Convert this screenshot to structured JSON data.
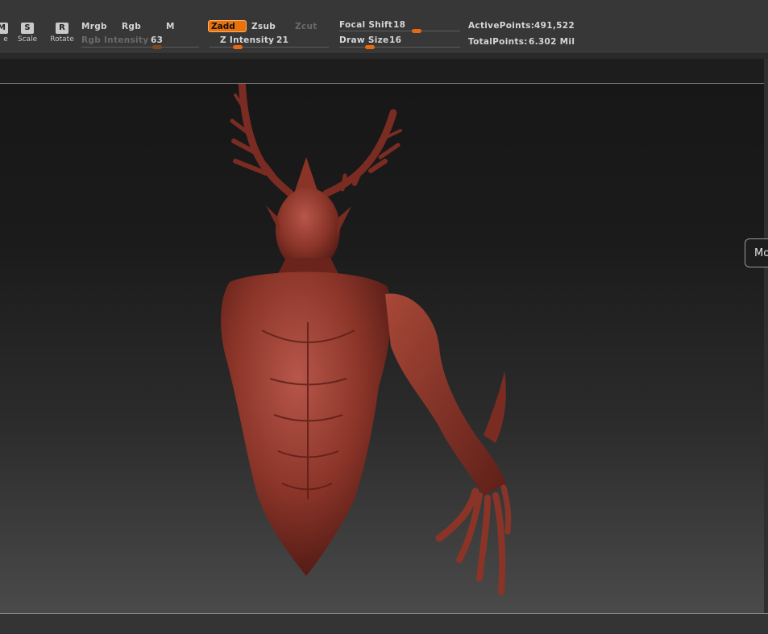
{
  "toolbar": {
    "move_glyph": "M",
    "move_label": "e",
    "scale_glyph": "S",
    "scale_label": "Scale",
    "rotate_glyph": "R",
    "rotate_label": "Rotate",
    "mrgb": "Mrgb",
    "rgb": "Rgb",
    "m": "M",
    "rgb_intensity_label": "Rgb Intensity",
    "rgb_intensity_value": "63",
    "zadd": "Zadd",
    "zsub": "Zsub",
    "zcut": "Zcut",
    "z_intensity_label": "Z Intensity",
    "z_intensity_value": "21",
    "focal_shift_label": "Focal Shift",
    "focal_shift_value": "18",
    "draw_size_label": "Draw Size",
    "draw_size_value": "16",
    "active_points_label": "ActivePoints:",
    "active_points_value": "491,522",
    "total_points_label": "TotalPoints:",
    "total_points_value": "6.302 Mil"
  },
  "side_tab": {
    "label": "Mo"
  },
  "colors": {
    "accent": "#e8720c",
    "model": "#8a3428",
    "toolbar_bg": "#373737"
  }
}
